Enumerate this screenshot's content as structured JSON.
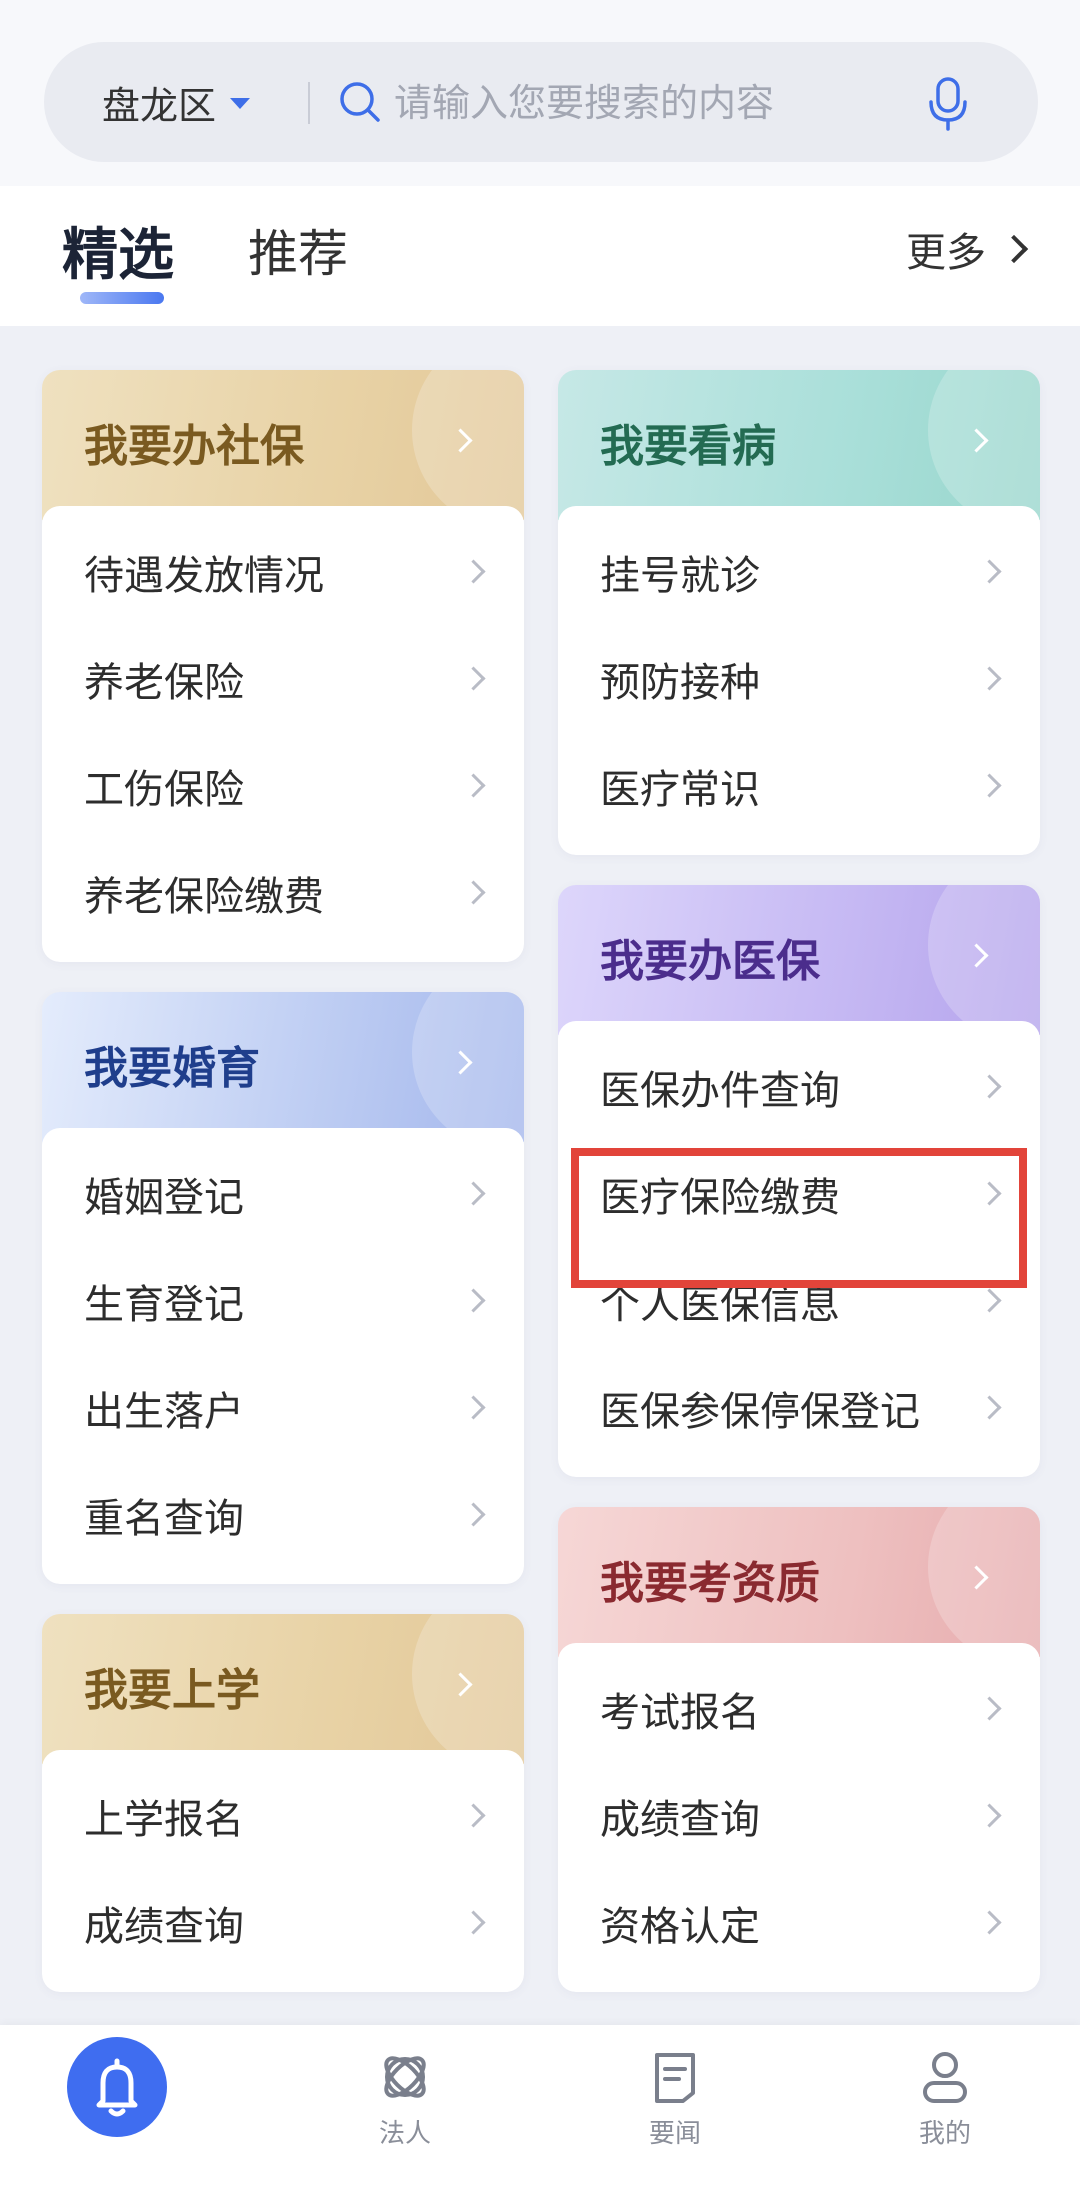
{
  "search": {
    "region": "盘龙区",
    "placeholder": "请输入您要搜索的内容"
  },
  "tabs": {
    "active": "精选",
    "other": "推荐",
    "more": "更多"
  },
  "cards": {
    "shebao": {
      "title": "我要办社保",
      "items": [
        "待遇发放情况",
        "养老保险",
        "工伤保险",
        "养老保险缴费"
      ]
    },
    "kanbing": {
      "title": "我要看病",
      "items": [
        "挂号就诊",
        "预防接种",
        "医疗常识"
      ]
    },
    "hunyu": {
      "title": "我要婚育",
      "items": [
        "婚姻登记",
        "生育登记",
        "出生落户",
        "重名查询"
      ]
    },
    "yibao": {
      "title": "我要办医保",
      "items": [
        "医保办件查询",
        "医疗保险缴费",
        "个人医保信息",
        "医保参保停保登记"
      ]
    },
    "zizhi": {
      "title": "我要考资质",
      "items": [
        "考试报名",
        "成绩查询",
        "资格认定"
      ]
    },
    "shangxue": {
      "title": "我要上学",
      "items": [
        "上学报名",
        "成绩查询"
      ]
    }
  },
  "bottom_nav": {
    "home": "",
    "faren": "法人",
    "yaowen": "要闻",
    "wode": "我的"
  },
  "colors": {
    "accent": "#3f6df0",
    "highlight": "#e2443a"
  }
}
